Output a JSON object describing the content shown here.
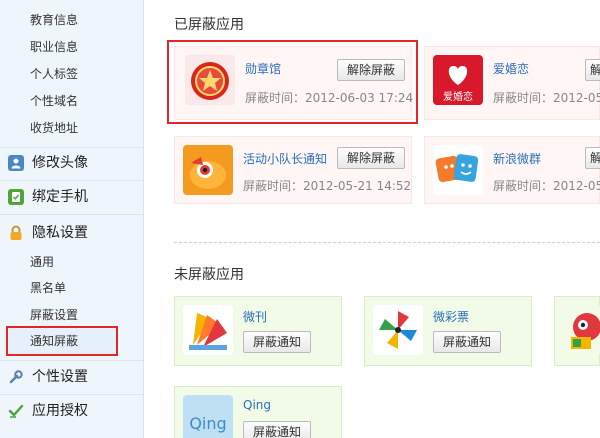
{
  "sidebar": {
    "top_items": [
      "教育信息",
      "职业信息",
      "个人标签",
      "个性域名",
      "收货地址"
    ],
    "sections": {
      "avatar": "修改头像",
      "phone": "绑定手机",
      "privacy": "隐私设置",
      "personal": "个性设置",
      "auth": "应用授权"
    },
    "privacy_items": [
      "通用",
      "黑名单",
      "屏蔽设置",
      "通知屏蔽"
    ],
    "active_item": "通知屏蔽"
  },
  "blocked_section": {
    "title": "已屏蔽应用",
    "apps": [
      {
        "name": "勋章馆",
        "time": "屏蔽时间：2012-06-03 17:24",
        "button": "解除屏蔽"
      },
      {
        "name": "爱婚恋",
        "time": "屏蔽时间：2012-05-",
        "button": "解"
      },
      {
        "name": "活动小队长通知",
        "time": "屏蔽时间：2012-05-21 14:52",
        "button": "解除屏蔽"
      },
      {
        "name": "新浪微群",
        "time": "屏蔽时间：2012-05-",
        "button": "解"
      }
    ],
    "love_icon_text": "爱婚恋"
  },
  "unblocked_section": {
    "title": "未屏蔽应用",
    "apps": [
      {
        "name": "微刊",
        "button": "屏蔽通知"
      },
      {
        "name": "微彩票",
        "button": "屏蔽通知"
      },
      {
        "name": "",
        "button": ""
      },
      {
        "name": "Qing",
        "button": "屏蔽通知"
      }
    ],
    "qing_icon_text": "Qing"
  },
  "colors": {
    "highlight": "#e2272c",
    "link": "#2a6ebb",
    "blocked_bg": "#fff6f5",
    "unblocked_bg": "#f1fbe8"
  },
  "icons": {
    "avatar": "person-icon",
    "phone": "phone-check-icon",
    "privacy": "lock-icon",
    "personal": "wrench-icon",
    "auth": "check-icon"
  }
}
